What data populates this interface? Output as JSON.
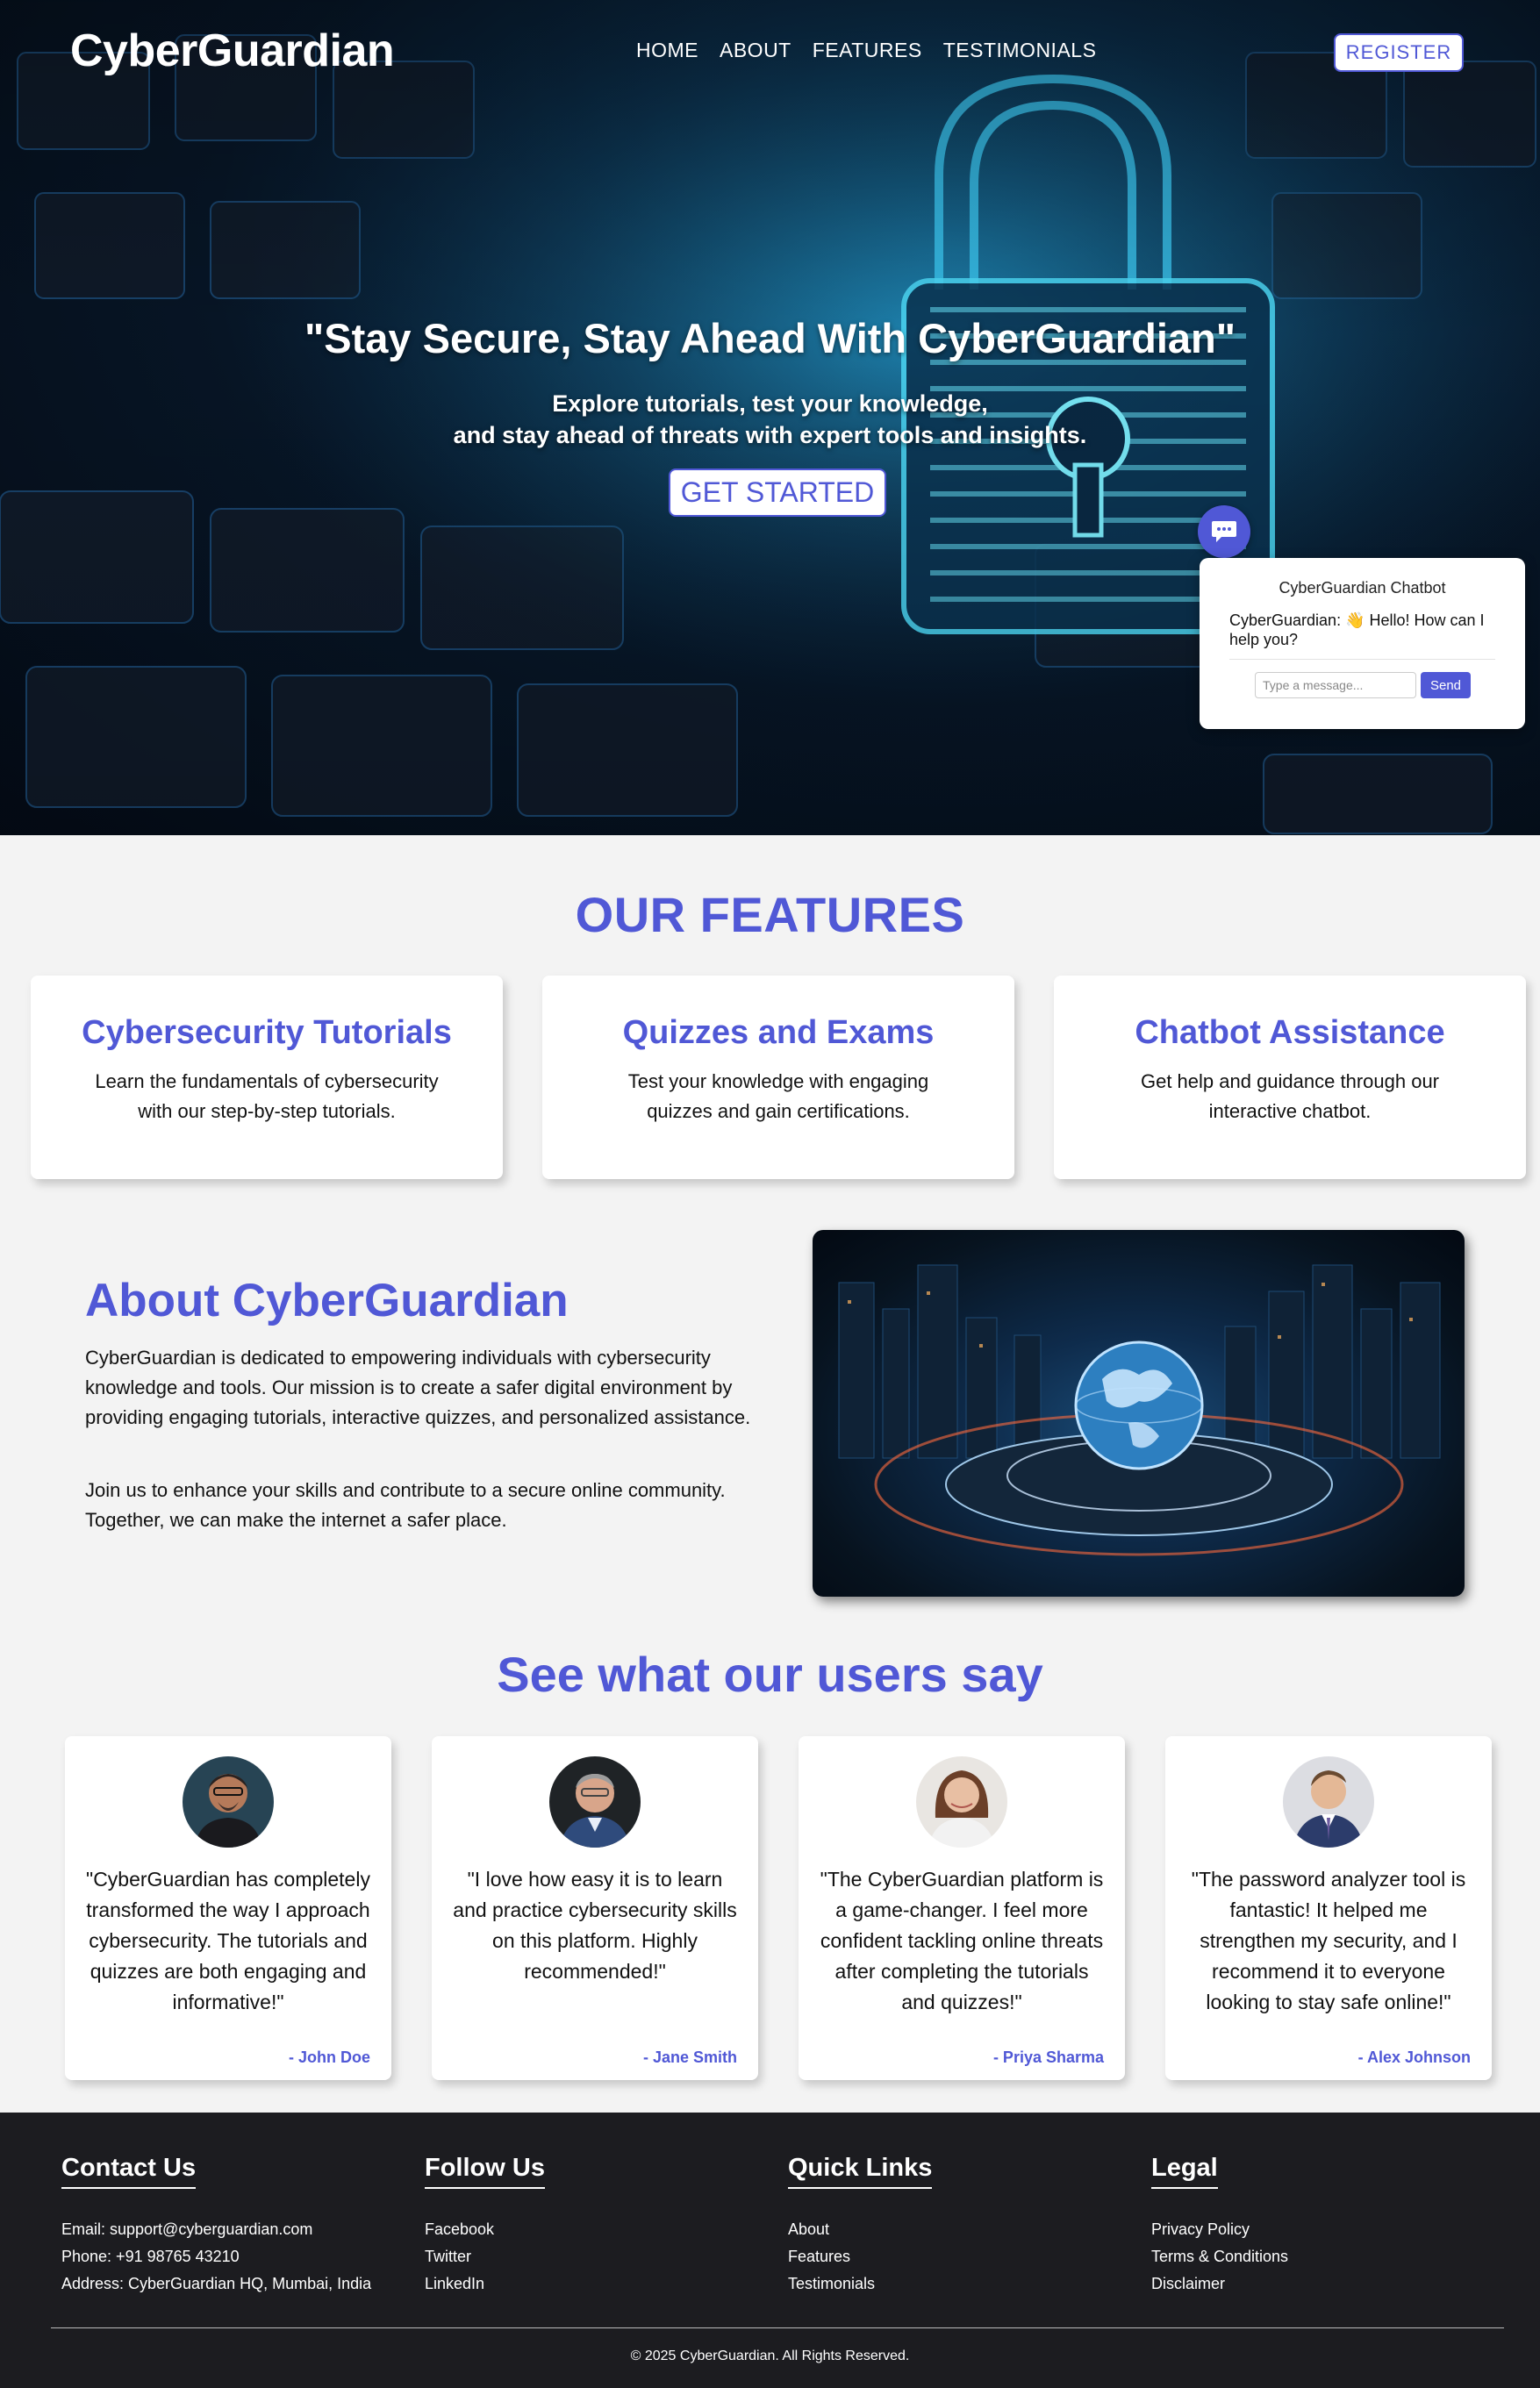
{
  "header": {
    "logo": "CyberGuardian",
    "nav": [
      "HOME",
      "ABOUT",
      "FEATURES",
      "TESTIMONIALS"
    ],
    "register_label": "REGISTER"
  },
  "hero": {
    "title": "\"Stay Secure, Stay Ahead With CyberGuardian\"",
    "subtitle_line1": "Explore tutorials, test your knowledge,",
    "subtitle_line2": "and stay ahead of threats with expert tools and insights.",
    "cta_label": "GET STARTED"
  },
  "chatbot": {
    "title": "CyberGuardian Chatbot",
    "message": "CyberGuardian: 👋 Hello! How can I help you?",
    "input_placeholder": "Type a message...",
    "send_label": "Send"
  },
  "features": {
    "title": "OUR FEATURES",
    "items": [
      {
        "title": "Cybersecurity Tutorials",
        "desc": "Learn the fundamentals of cybersecurity with our step-by-step tutorials."
      },
      {
        "title": "Quizzes and Exams",
        "desc": "Test your knowledge with engaging quizzes and gain certifications."
      },
      {
        "title": "Chatbot Assistance",
        "desc": "Get help and guidance through our interactive chatbot."
      }
    ]
  },
  "about": {
    "title": "About CyberGuardian",
    "p1": "CyberGuardian is dedicated to empowering individuals with cybersecurity knowledge and tools. Our mission is to create a safer digital environment by providing engaging tutorials, interactive quizzes, and personalized assistance.",
    "p2": "Join us to enhance your skills and contribute to a secure online community. Together, we can make the internet a safer place."
  },
  "testimonials": {
    "title": "See what our users say",
    "items": [
      {
        "quote": "\"CyberGuardian has completely transformed the way I approach cybersecurity. The tutorials and quizzes are both engaging and informative!\"",
        "author": "- John Doe"
      },
      {
        "quote": "\"I love how easy it is to learn and practice cybersecurity skills on this platform. Highly recommended!\"",
        "author": "- Jane Smith"
      },
      {
        "quote": "\"The CyberGuardian platform is a game-changer. I feel more confident tackling online threats after completing the tutorials and quizzes!\"",
        "author": "- Priya Sharma"
      },
      {
        "quote": "\"The password analyzer tool is fantastic! It helped me strengthen my security, and I recommend it to everyone looking to stay safe online!\"",
        "author": "- Alex Johnson"
      }
    ]
  },
  "footer": {
    "contact": {
      "title": "Contact Us",
      "items": [
        "Email: support@cyberguardian.com",
        "Phone: +91 98765 43210",
        "Address: CyberGuardian HQ, Mumbai, India"
      ]
    },
    "follow": {
      "title": "Follow Us",
      "items": [
        "Facebook",
        "Twitter",
        "LinkedIn"
      ]
    },
    "quick": {
      "title": "Quick Links",
      "items": [
        "About",
        "Features",
        "Testimonials"
      ]
    },
    "legal": {
      "title": "Legal",
      "items": [
        "Privacy Policy",
        "Terms & Conditions",
        "Disclaimer"
      ]
    },
    "copyright": "© 2025 CyberGuardian. All Rights Reserved."
  },
  "colors": {
    "accent": "#5058d6",
    "footer_bg": "#1c1c20",
    "page_bg": "#f3f3f3"
  },
  "icons": {
    "chat_toggle": "chat-bubble-icon"
  }
}
